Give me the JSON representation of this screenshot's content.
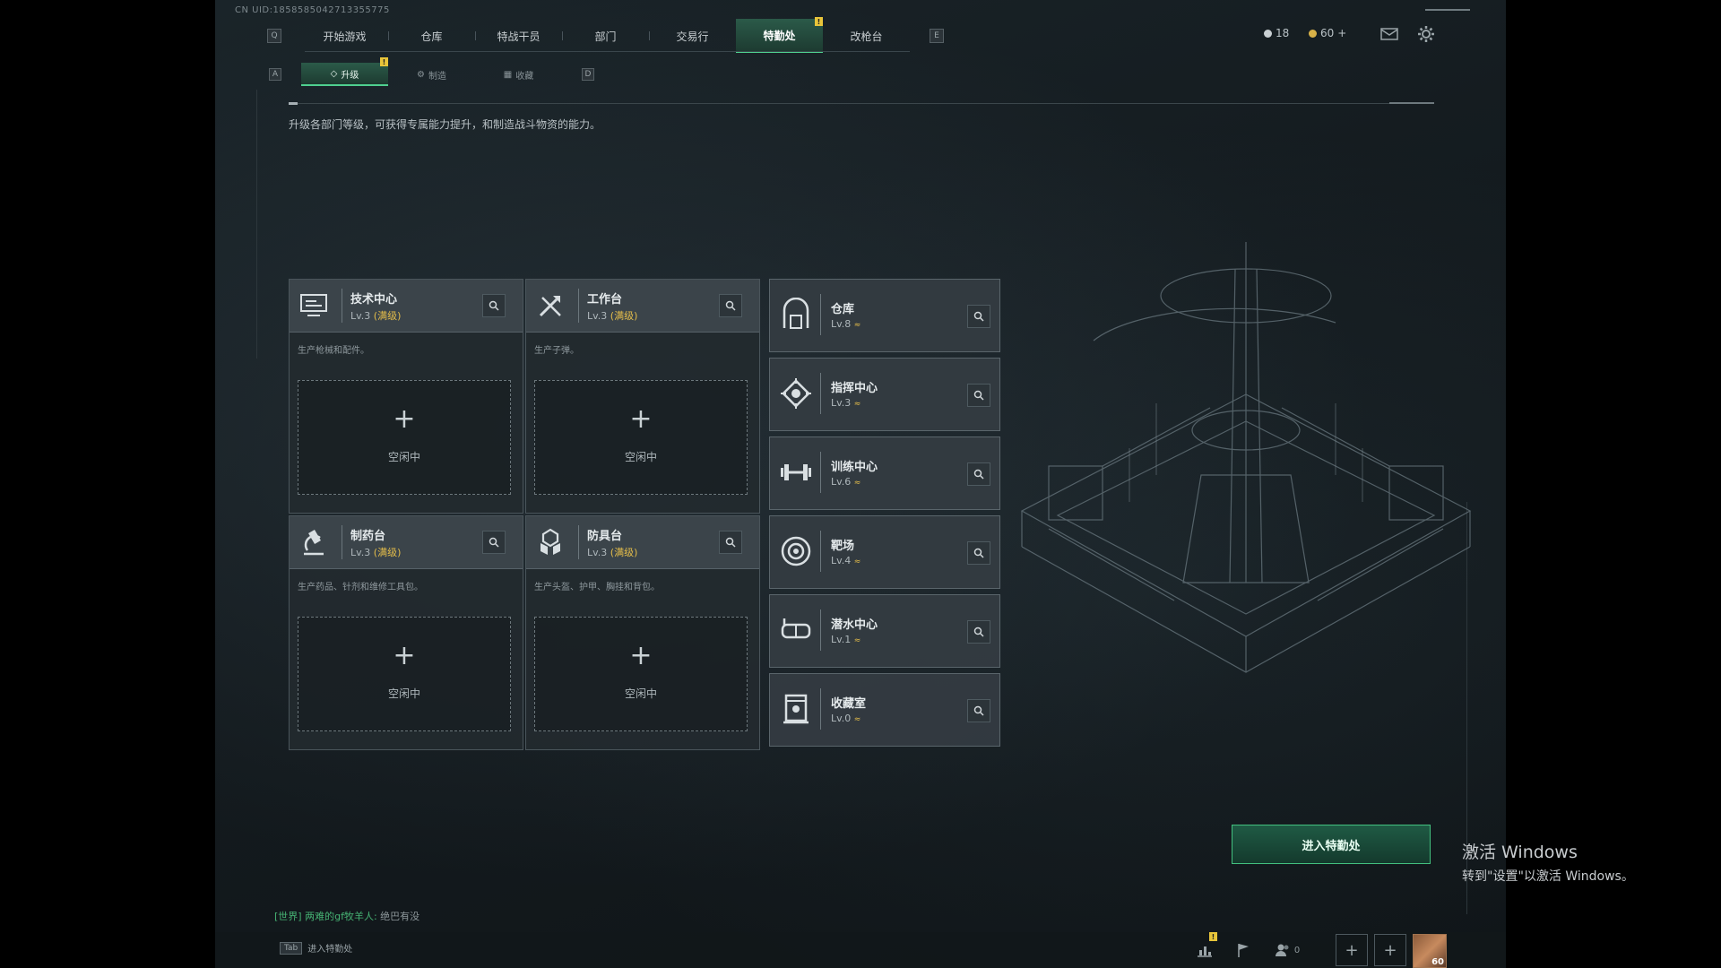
{
  "uid": "CN UID:1858585042713355775",
  "nav": {
    "key_left": "Q",
    "key_right": "E",
    "tabs": [
      "开始游戏",
      "仓库",
      "特战干员",
      "部门",
      "交易行",
      "特勤处",
      "改枪台"
    ],
    "active": "特勤处",
    "alert_badge": "!"
  },
  "resources": {
    "item1": "18",
    "item2": "60",
    "plus": "+"
  },
  "subnav": {
    "key_left": "A",
    "key_right": "D",
    "tabs": [
      "升级",
      "制造",
      "收藏"
    ],
    "active": "升级",
    "alert_badge": "!"
  },
  "description": "升级各部门等级，可获得专属能力提升，和制造战斗物资的能力。",
  "workshops": [
    {
      "name": "技术中心",
      "level": "Lv.3",
      "max": "(满级)",
      "desc": "生产枪械和配件。",
      "slot_plus": "+",
      "slot_status": "空闲中",
      "icon": "monitor-icon"
    },
    {
      "name": "工作台",
      "level": "Lv.3",
      "max": "(满级)",
      "desc": "生产子弹。",
      "slot_plus": "+",
      "slot_status": "空闲中",
      "icon": "tools-icon"
    },
    {
      "name": "制药台",
      "level": "Lv.3",
      "max": "(满级)",
      "desc": "生产药品、针剂和维修工具包。",
      "slot_plus": "+",
      "slot_status": "空闲中",
      "icon": "microscope-icon"
    },
    {
      "name": "防具台",
      "level": "Lv.3",
      "max": "(满级)",
      "desc": "生产头盔、护甲、胸挂和背包。",
      "slot_plus": "+",
      "slot_status": "空闲中",
      "icon": "armor-icon"
    }
  ],
  "departments": [
    {
      "name": "仓库",
      "level": "Lv.8",
      "icon": "warehouse-icon"
    },
    {
      "name": "指挥中心",
      "level": "Lv.3",
      "icon": "command-icon"
    },
    {
      "name": "训练中心",
      "level": "Lv.6",
      "icon": "dumbbell-icon"
    },
    {
      "name": "靶场",
      "level": "Lv.4",
      "icon": "target-icon"
    },
    {
      "name": "潜水中心",
      "level": "Lv.1",
      "icon": "diving-mask-icon"
    },
    {
      "name": "收藏室",
      "level": "Lv.0",
      "icon": "trophy-case-icon"
    }
  ],
  "upgrade_symbol": "≈",
  "enter_button": "进入特勤处",
  "chat": {
    "channel": "[世界]",
    "user": "两难的gf牧羊人:",
    "message": "绝巴有没"
  },
  "bottom": {
    "tab_key": "Tab",
    "tab_label": "进入特勤处",
    "friends_count": "0",
    "avatar_level": "60",
    "alert_badge": "!"
  },
  "watermark": {
    "line1": "激活 Windows",
    "line2": "转到\"设置\"以激活 Windows。"
  },
  "colors": {
    "accent_green": "#4fd08f",
    "max_level_gold": "#e4bd4a",
    "badge_yellow": "#e8c53a"
  }
}
